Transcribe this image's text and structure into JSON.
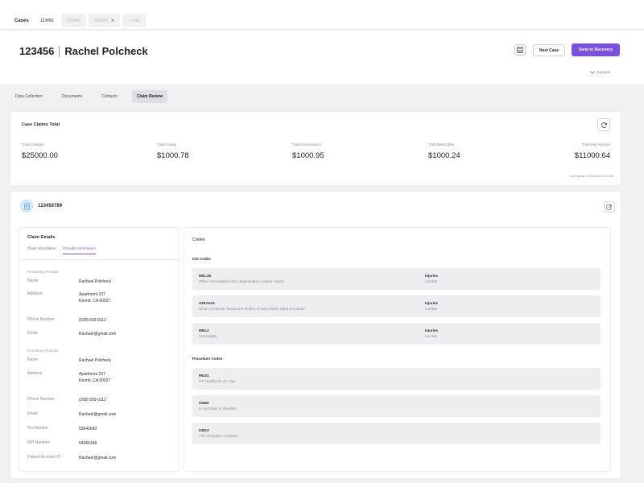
{
  "top_tabs": {
    "cases_label": "Cases",
    "tabs": [
      {
        "label": "123456",
        "active": true
      },
      {
        "label": "225465",
        "active": false
      },
      {
        "label": "990000",
        "active": false,
        "closable": true
      }
    ],
    "new_tab_label": "+ Tabs"
  },
  "header": {
    "case_id": "123456",
    "patient_name": "Rachel Polcheck",
    "next_case_label": "Next Case",
    "send_recovery_label": "Send to Recovery",
    "expand_label": "Expand"
  },
  "section_tabs": [
    {
      "label": "Data Collection",
      "active": false
    },
    {
      "label": "Documents",
      "active": false
    },
    {
      "label": "Contacts",
      "active": false
    },
    {
      "label": "Claim Review",
      "active": true
    }
  ],
  "totals": {
    "title": "Case Claims Total",
    "items": [
      {
        "label": "Total Charges",
        "value": "$25000.00"
      },
      {
        "label": "Total Copay",
        "value": "$1000.78"
      },
      {
        "label": "Total Coinsurance",
        "value": "$1000.95"
      },
      {
        "label": "Total Deductible",
        "value": "$1000.24"
      },
      {
        "label": "Total Pay Amount",
        "value": "$11000.64"
      }
    ],
    "last_update": "Last Update: 12/24/2023 10:15:35"
  },
  "claim": {
    "id": "123456789",
    "details_title": "Claim Details",
    "subtabs": [
      {
        "label": "Claim Information",
        "active": false
      },
      {
        "label": "Provider Information",
        "active": true
      }
    ],
    "rendering1": {
      "section": "Rendering Provider",
      "name_k": "Name",
      "name_v": "Rachael Polcheck",
      "addr_k": "Address",
      "addr_v1": "Apartment 237",
      "addr_v2": "Kermit, CA 90027",
      "phone_k": "Phone Number",
      "phone_v": "(208) 555-0112",
      "email_k": "Email",
      "email_v": "Rachael@gmail.com"
    },
    "rendering2": {
      "section": "Rendering Provider",
      "name_k": "Name",
      "name_v": "Rachael Polcheck",
      "addr_k": "Address",
      "addr_v1": "Apartment 237",
      "addr_v2": "Kermit, CA 90027",
      "phone_k": "Phone Number",
      "phone_v": "(208) 555-0112",
      "email_k": "Email",
      "email_v": "Rachael@gmail.com",
      "tin_k": "Tin Number",
      "tin_v": "53643643",
      "npi_k": "NPI Number",
      "npi_v": "54365348",
      "pan_k": "Patient Account ID",
      "pan_v": "Rachael@gmail.com"
    },
    "codes": {
      "title": "Codes",
      "icd_title": "ICD Codes",
      "icd": [
        {
          "code": "M51.36",
          "desc": "Other intervertebral disc degeneration, lumbar region",
          "type": "Injuries",
          "area": "Lumbar"
        },
        {
          "code": "S39.012A",
          "desc": "Strain of muscle, fascia and tendon of lower back, initial encounter",
          "type": "Injuries",
          "area": "Lumbar"
        },
        {
          "code": "M54.2",
          "desc": "Cervicalgia",
          "type": "Injuries",
          "area": "Lumbar"
        }
      ],
      "proc_title": "Procedure Codes",
      "procedures": [
        {
          "code": "99231",
          "desc": "CT head/brain w/o dye"
        },
        {
          "code": "23462",
          "desc": "X-ray Exam of shoulder"
        },
        {
          "code": "24513",
          "desc": "TTE w/doppler complete"
        }
      ]
    }
  },
  "colors": {
    "accent": "#7b4fe0",
    "panel_bg": "#f1f1f3",
    "code_bg": "#eeeef1"
  },
  "icons": {
    "save": "floppy-disk-icon",
    "refresh": "refresh-icon",
    "edit": "edit-icon",
    "expand": "chevron-down-icon",
    "claim_badge": "claim-badge-icon",
    "close": "close-icon"
  }
}
